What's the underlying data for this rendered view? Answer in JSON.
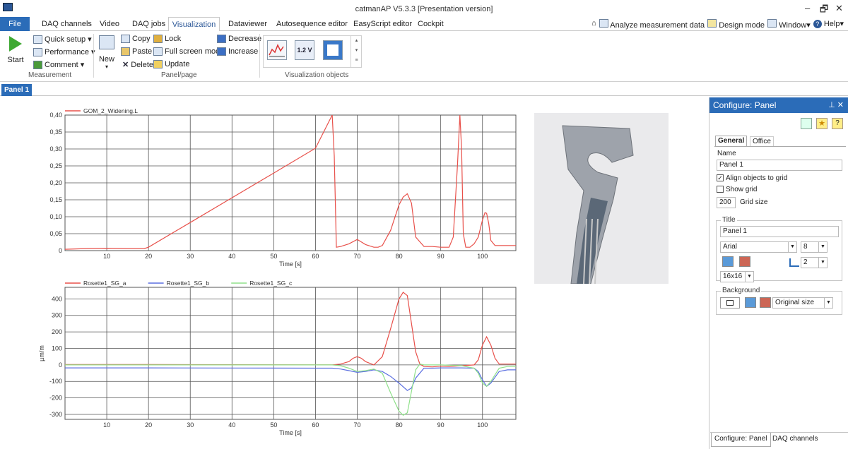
{
  "window": {
    "title": "catmanAP V5.3.3 [Presentation version]",
    "minimize": "–",
    "restore": "🗗",
    "close": "✕"
  },
  "tabs": {
    "file": "File",
    "items": [
      "DAQ channels",
      "Video",
      "DAQ jobs",
      "Visualization",
      "Dataviewer",
      "Autosequence editor",
      "EasyScript editor",
      "Cockpit"
    ],
    "active": "Visualization"
  },
  "rightlinks": {
    "analyze": "Analyze measurement data",
    "design": "Design mode",
    "window": "Window",
    "help": "Help"
  },
  "ribbon": {
    "start": "Start",
    "quick_setup": "Quick setup",
    "performance": "Performance",
    "comment": "Comment",
    "measurement_group": "Measurement",
    "new": "New",
    "copy": "Copy",
    "paste": "Paste",
    "delete": "Delete",
    "lock": "Lock",
    "fullscreen": "Full screen mode",
    "update": "Update",
    "decrease": "Decrease",
    "increase": "Increase",
    "panel_group": "Panel/page",
    "vis_group": "Visualization objects",
    "vis_voltage": "1.2 V"
  },
  "panel_tab": "Panel 1",
  "chart_data": [
    {
      "type": "line",
      "series": [
        {
          "name": "GOM_2_Widening.L",
          "color": "#e8504a",
          "x": [
            0,
            5,
            10,
            15,
            19,
            20,
            30,
            40,
            50,
            60,
            64,
            64.5,
            65,
            66,
            68,
            70,
            72,
            74,
            75,
            76,
            78,
            80,
            81,
            82,
            83,
            84,
            86,
            88,
            90,
            92,
            93,
            94,
            94.6,
            95,
            95.4,
            96,
            97,
            98,
            99,
            100,
            100.6,
            101,
            101.5,
            102,
            103,
            105,
            108
          ],
          "values": [
            0.004,
            0.006,
            0.007,
            0.006,
            0.006,
            0.01,
            0.083,
            0.156,
            0.229,
            0.302,
            0.4,
            0.28,
            0.01,
            0.012,
            0.02,
            0.033,
            0.018,
            0.01,
            0.01,
            0.015,
            0.06,
            0.135,
            0.158,
            0.168,
            0.14,
            0.04,
            0.012,
            0.012,
            0.01,
            0.01,
            0.04,
            0.25,
            0.4,
            0.3,
            0.05,
            0.01,
            0.01,
            0.02,
            0.04,
            0.09,
            0.112,
            0.11,
            0.08,
            0.03,
            0.015,
            0.015,
            0.015
          ]
        }
      ],
      "xlabel": "Time  [s]",
      "ylabel": "",
      "xlim": [
        0,
        108
      ],
      "ylim": [
        0,
        0.4
      ],
      "xticks": [
        10,
        20,
        30,
        40,
        50,
        60,
        70,
        80,
        90,
        100
      ],
      "yticks": [
        "0",
        "0,05",
        "0,10",
        "0,15",
        "0,20",
        "0,25",
        "0,30",
        "0,35",
        "0,40"
      ]
    },
    {
      "type": "line",
      "series": [
        {
          "name": "Rosette1_SG_a",
          "color": "#e8504a",
          "x": [
            0,
            20,
            40,
            60,
            64,
            66,
            68,
            69,
            70,
            71,
            72,
            74,
            76,
            78,
            80,
            81,
            82,
            83,
            84,
            85,
            86,
            88,
            90,
            92,
            95,
            98,
            99,
            100,
            101,
            102,
            103,
            104,
            106,
            108
          ],
          "values": [
            2,
            2,
            1,
            0,
            0,
            5,
            20,
            40,
            50,
            40,
            20,
            0,
            50,
            220,
            400,
            440,
            420,
            250,
            80,
            5,
            -10,
            -12,
            -8,
            -10,
            -5,
            0,
            30,
            120,
            170,
            120,
            40,
            5,
            5,
            5
          ]
        },
        {
          "name": "Rosette1_SG_b",
          "color": "#5b6fe0",
          "x": [
            0,
            20,
            40,
            60,
            64,
            66,
            68,
            70,
            72,
            74,
            76,
            78,
            80,
            82,
            83,
            84,
            86,
            88,
            90,
            95,
            98,
            99,
            100,
            101,
            102,
            104,
            106,
            108
          ],
          "values": [
            -18,
            -18,
            -19,
            -20,
            -20,
            -25,
            -35,
            -45,
            -40,
            -30,
            -40,
            -70,
            -110,
            -155,
            -140,
            -80,
            -20,
            -20,
            -18,
            -18,
            -20,
            -40,
            -90,
            -130,
            -110,
            -40,
            -30,
            -30
          ]
        },
        {
          "name": "Rosette1_SG_c",
          "color": "#8fe08a",
          "x": [
            0,
            20,
            40,
            60,
            64,
            66,
            68,
            70,
            72,
            74,
            76,
            78,
            80,
            81,
            82,
            83,
            84,
            85,
            86,
            88,
            90,
            95,
            98,
            99,
            100,
            101,
            102,
            104,
            106,
            108
          ],
          "values": [
            0,
            0,
            0,
            0,
            0,
            -5,
            -20,
            -40,
            -35,
            -25,
            -50,
            -170,
            -280,
            -305,
            -290,
            -160,
            -30,
            5,
            0,
            0,
            0,
            -5,
            -20,
            -50,
            -110,
            -130,
            -100,
            -20,
            -10,
            -10
          ]
        }
      ],
      "xlabel": "Time  [s]",
      "ylabel": "µm/m",
      "xlim": [
        0,
        108
      ],
      "ylim": [
        -330,
        470
      ],
      "xticks": [
        10,
        20,
        30,
        40,
        50,
        60,
        70,
        80,
        90,
        100
      ],
      "yticks": [
        "-300",
        "-200",
        "-100",
        "0",
        "100",
        "200",
        "300",
        "400"
      ]
    }
  ],
  "config": {
    "header": "Configure: Panel",
    "tab_general": "General",
    "tab_office": "Office",
    "name_label": "Name",
    "name_value": "Panel 1",
    "align_label": "Align objects to grid",
    "align_checked": true,
    "show_grid_label": "Show grid",
    "show_grid_checked": false,
    "grid_size_value": "200",
    "grid_size_label": "Grid size",
    "title_legend": "Title",
    "title_value": "Panel 1",
    "font_value": "Arial",
    "font_size": "8",
    "icon_size": "16x16",
    "position_value": "2",
    "background_legend": "Background",
    "background_mode": "Original size",
    "bottom_tab1": "Configure: Panel",
    "bottom_tab2": "DAQ channels"
  }
}
